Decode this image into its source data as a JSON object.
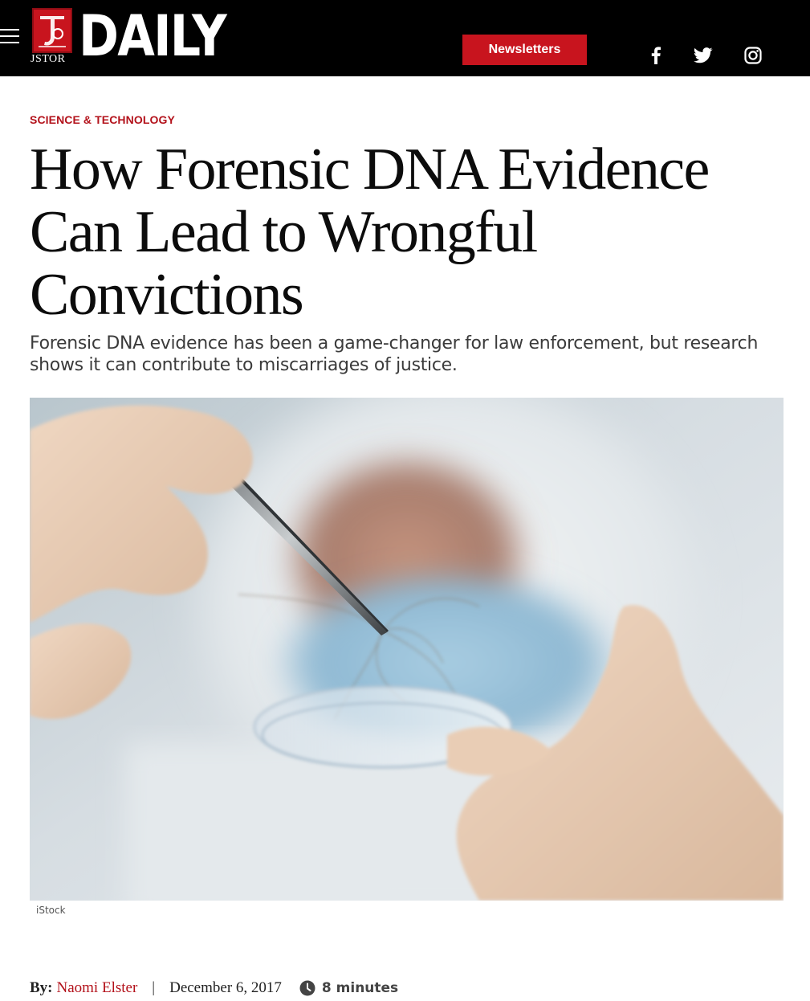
{
  "header": {
    "menu_icon": "hamburger-menu-icon",
    "logo": {
      "jstor": "JSTOR",
      "daily": "DAILY"
    },
    "newsletters_label": "Newsletters",
    "social": [
      "facebook-icon",
      "twitter-icon",
      "instagram-icon"
    ]
  },
  "article": {
    "category": "SCIENCE & TECHNOLOGY",
    "title": "How Forensic DNA Evidence Can Lead to Wrongful Convictions",
    "dek": "Forensic DNA evidence has been a game-changer for law enforcement, but research shows it can contribute to miscarriages of justice.",
    "image_credit": "iStock",
    "byline_label": "By:",
    "author": "Naomi Elster",
    "separator": "|",
    "date": "December 6, 2017",
    "read_time": "8 minutes"
  },
  "colors": {
    "accent": "#c8141e",
    "header_bg": "#000000",
    "text": "#0c0c0c",
    "dek": "#3b3b3b"
  }
}
